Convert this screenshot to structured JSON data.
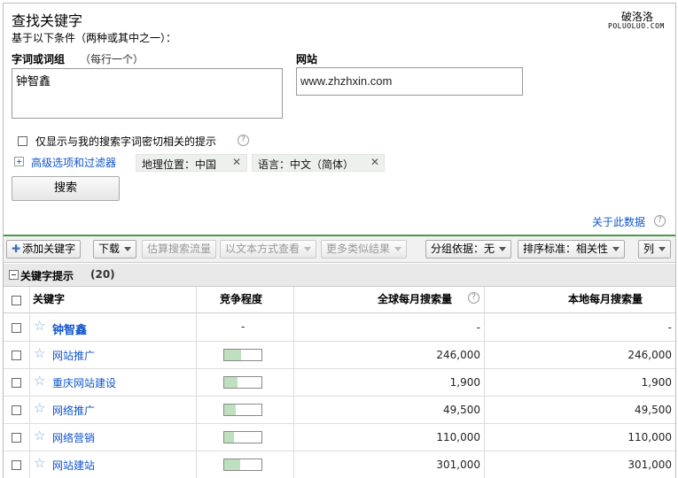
{
  "header": {
    "title": "查找关键字",
    "subtitle": "基于以下条件（两种或其中之一）：",
    "watermark_cn": "破洛洛",
    "watermark_en": "POLUOLUO.COM"
  },
  "form": {
    "keywords_label": "字词或词组",
    "keywords_hint": "（每行一个）",
    "keywords_value": "钟智鑫",
    "website_label": "网站",
    "website_value": "www.zhzhxin.com",
    "exact_checkbox_label": "仅显示与我的搜索字词密切相关的提示",
    "advanced_link": "高级选项和过滤器",
    "filters": [
      {
        "label": "地理位置：中国"
      },
      {
        "label": "语言：中文（简体）"
      }
    ],
    "remove_symbol": "✕",
    "search_button": "搜索",
    "about_data_link": "关于此数据"
  },
  "toolbar": {
    "add_keyword": "添加关键字",
    "download": "下载",
    "estimate_traffic": "估算搜索流量",
    "view_as_text": "以文本方式查看",
    "more_like": "更多类似结果",
    "group_by": "分组依据：无",
    "sort_by": "排序标准：相关性",
    "columns": "列"
  },
  "section": {
    "title": "关键字提示",
    "count": "(20)"
  },
  "table": {
    "headers": {
      "keyword": "关键字",
      "competition": "竞争程度",
      "global_monthly": "全球每月搜索量",
      "local_monthly": "本地每月搜索量"
    },
    "rows": [
      {
        "keyword": "钟智鑫",
        "competition_text": "-",
        "global": "-",
        "local": "-",
        "bold": true
      },
      {
        "keyword": "网站推广",
        "competition": 0.45,
        "global": "246,000",
        "local": "246,000"
      },
      {
        "keyword": "重庆网站建设",
        "competition": 0.35,
        "global": "1,900",
        "local": "1,900"
      },
      {
        "keyword": "网络推广",
        "competition": 0.32,
        "global": "49,500",
        "local": "49,500"
      },
      {
        "keyword": "网络营销",
        "competition": 0.25,
        "global": "110,000",
        "local": "110,000"
      },
      {
        "keyword": "网站建站",
        "competition": 0.42,
        "global": "301,000",
        "local": "301,000"
      }
    ]
  }
}
